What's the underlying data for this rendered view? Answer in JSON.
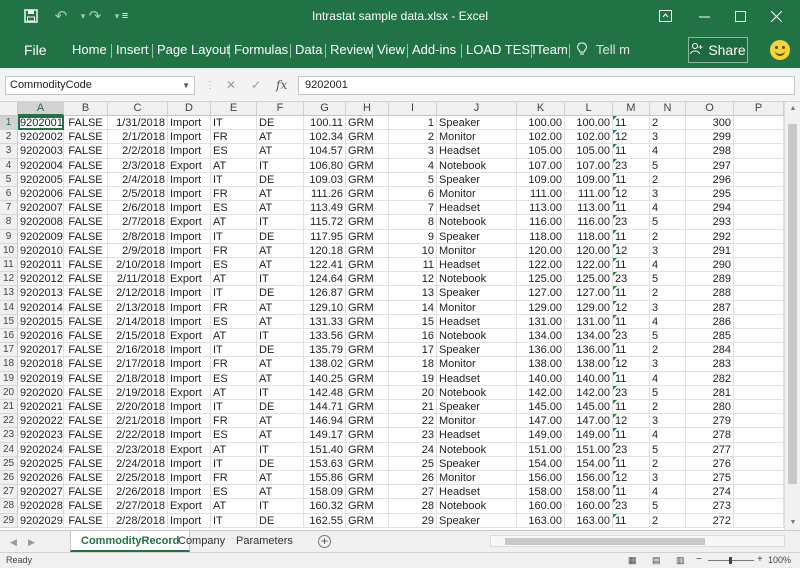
{
  "window": {
    "title": "Intrastat sample data.xlsx - Excel"
  },
  "ribbon": {
    "file": "File",
    "tabs": [
      "Home",
      "Insert",
      "Page Layout",
      "Formulas",
      "Data",
      "Review",
      "View",
      "Add-ins",
      "LOAD TEST",
      "Team"
    ],
    "tell_me": "Tell m",
    "share": "Share"
  },
  "formula_bar": {
    "name_box": "CommodityCode",
    "value": "9202001"
  },
  "columns": [
    "A",
    "B",
    "C",
    "D",
    "E",
    "F",
    "G",
    "H",
    "I",
    "J",
    "K",
    "L",
    "M",
    "N",
    "O",
    "P"
  ],
  "selected_cell": "A1",
  "rows": [
    [
      "9202001",
      "FALSE",
      "1/31/2018",
      "Import",
      "IT",
      "DE",
      "100.11",
      "GRM",
      "1",
      "Speaker",
      "100.00",
      "100.00",
      "11",
      "2",
      "300"
    ],
    [
      "9202002",
      "FALSE",
      "2/1/2018",
      "Import",
      "FR",
      "AT",
      "102.34",
      "GRM",
      "2",
      "Monitor",
      "102.00",
      "102.00",
      "12",
      "3",
      "299"
    ],
    [
      "9202003",
      "FALSE",
      "2/2/2018",
      "Import",
      "ES",
      "AT",
      "104.57",
      "GRM",
      "3",
      "Headset",
      "105.00",
      "105.00",
      "11",
      "4",
      "298"
    ],
    [
      "9202004",
      "FALSE",
      "2/3/2018",
      "Export",
      "AT",
      "IT",
      "106.80",
      "GRM",
      "4",
      "Notebook",
      "107.00",
      "107.00",
      "23",
      "5",
      "297"
    ],
    [
      "9202005",
      "FALSE",
      "2/4/2018",
      "Import",
      "IT",
      "DE",
      "109.03",
      "GRM",
      "5",
      "Speaker",
      "109.00",
      "109.00",
      "11",
      "2",
      "296"
    ],
    [
      "9202006",
      "FALSE",
      "2/5/2018",
      "Import",
      "FR",
      "AT",
      "111.26",
      "GRM",
      "6",
      "Monitor",
      "111.00",
      "111.00",
      "12",
      "3",
      "295"
    ],
    [
      "9202007",
      "FALSE",
      "2/6/2018",
      "Import",
      "ES",
      "AT",
      "113.49",
      "GRM",
      "7",
      "Headset",
      "113.00",
      "113.00",
      "11",
      "4",
      "294"
    ],
    [
      "9202008",
      "FALSE",
      "2/7/2018",
      "Export",
      "AT",
      "IT",
      "115.72",
      "GRM",
      "8",
      "Notebook",
      "116.00",
      "116.00",
      "23",
      "5",
      "293"
    ],
    [
      "9202009",
      "FALSE",
      "2/8/2018",
      "Import",
      "IT",
      "DE",
      "117.95",
      "GRM",
      "9",
      "Speaker",
      "118.00",
      "118.00",
      "11",
      "2",
      "292"
    ],
    [
      "9202010",
      "FALSE",
      "2/9/2018",
      "Import",
      "FR",
      "AT",
      "120.18",
      "GRM",
      "10",
      "Monitor",
      "120.00",
      "120.00",
      "12",
      "3",
      "291"
    ],
    [
      "9202011",
      "FALSE",
      "2/10/2018",
      "Import",
      "ES",
      "AT",
      "122.41",
      "GRM",
      "11",
      "Headset",
      "122.00",
      "122.00",
      "11",
      "4",
      "290"
    ],
    [
      "9202012",
      "FALSE",
      "2/11/2018",
      "Export",
      "AT",
      "IT",
      "124.64",
      "GRM",
      "12",
      "Notebook",
      "125.00",
      "125.00",
      "23",
      "5",
      "289"
    ],
    [
      "9202013",
      "FALSE",
      "2/12/2018",
      "Import",
      "IT",
      "DE",
      "126.87",
      "GRM",
      "13",
      "Speaker",
      "127.00",
      "127.00",
      "11",
      "2",
      "288"
    ],
    [
      "9202014",
      "FALSE",
      "2/13/2018",
      "Import",
      "FR",
      "AT",
      "129.10",
      "GRM",
      "14",
      "Monitor",
      "129.00",
      "129.00",
      "12",
      "3",
      "287"
    ],
    [
      "9202015",
      "FALSE",
      "2/14/2018",
      "Import",
      "ES",
      "AT",
      "131.33",
      "GRM",
      "15",
      "Headset",
      "131.00",
      "131.00",
      "11",
      "4",
      "286"
    ],
    [
      "9202016",
      "FALSE",
      "2/15/2018",
      "Export",
      "AT",
      "IT",
      "133.56",
      "GRM",
      "16",
      "Notebook",
      "134.00",
      "134.00",
      "23",
      "5",
      "285"
    ],
    [
      "9202017",
      "FALSE",
      "2/16/2018",
      "Import",
      "IT",
      "DE",
      "135.79",
      "GRM",
      "17",
      "Speaker",
      "136.00",
      "136.00",
      "11",
      "2",
      "284"
    ],
    [
      "9202018",
      "FALSE",
      "2/17/2018",
      "Import",
      "FR",
      "AT",
      "138.02",
      "GRM",
      "18",
      "Monitor",
      "138.00",
      "138.00",
      "12",
      "3",
      "283"
    ],
    [
      "9202019",
      "FALSE",
      "2/18/2018",
      "Import",
      "ES",
      "AT",
      "140.25",
      "GRM",
      "19",
      "Headset",
      "140.00",
      "140.00",
      "11",
      "4",
      "282"
    ],
    [
      "9202020",
      "FALSE",
      "2/19/2018",
      "Export",
      "AT",
      "IT",
      "142.48",
      "GRM",
      "20",
      "Notebook",
      "142.00",
      "142.00",
      "23",
      "5",
      "281"
    ],
    [
      "9202021",
      "FALSE",
      "2/20/2018",
      "Import",
      "IT",
      "DE",
      "144.71",
      "GRM",
      "21",
      "Speaker",
      "145.00",
      "145.00",
      "11",
      "2",
      "280"
    ],
    [
      "9202022",
      "FALSE",
      "2/21/2018",
      "Import",
      "FR",
      "AT",
      "146.94",
      "GRM",
      "22",
      "Monitor",
      "147.00",
      "147.00",
      "12",
      "3",
      "279"
    ],
    [
      "9202023",
      "FALSE",
      "2/22/2018",
      "Import",
      "ES",
      "AT",
      "149.17",
      "GRM",
      "23",
      "Headset",
      "149.00",
      "149.00",
      "11",
      "4",
      "278"
    ],
    [
      "9202024",
      "FALSE",
      "2/23/2018",
      "Export",
      "AT",
      "IT",
      "151.40",
      "GRM",
      "24",
      "Notebook",
      "151.00",
      "151.00",
      "23",
      "5",
      "277"
    ],
    [
      "9202025",
      "FALSE",
      "2/24/2018",
      "Import",
      "IT",
      "DE",
      "153.63",
      "GRM",
      "25",
      "Speaker",
      "154.00",
      "154.00",
      "11",
      "2",
      "276"
    ],
    [
      "9202026",
      "FALSE",
      "2/25/2018",
      "Import",
      "FR",
      "AT",
      "155.86",
      "GRM",
      "26",
      "Monitor",
      "156.00",
      "156.00",
      "12",
      "3",
      "275"
    ],
    [
      "9202027",
      "FALSE",
      "2/26/2018",
      "Import",
      "ES",
      "AT",
      "158.09",
      "GRM",
      "27",
      "Headset",
      "158.00",
      "158.00",
      "11",
      "4",
      "274"
    ],
    [
      "9202028",
      "FALSE",
      "2/27/2018",
      "Export",
      "AT",
      "IT",
      "160.32",
      "GRM",
      "28",
      "Notebook",
      "160.00",
      "160.00",
      "23",
      "5",
      "273"
    ],
    [
      "9202029",
      "FALSE",
      "2/28/2018",
      "Import",
      "IT",
      "DE",
      "162.55",
      "GRM",
      "29",
      "Speaker",
      "163.00",
      "163.00",
      "11",
      "2",
      "272"
    ]
  ],
  "sheet_tabs": {
    "active": "CommodityRecord",
    "others": [
      "Company",
      "Parameters"
    ]
  },
  "status": {
    "ready": "Ready",
    "zoom": "100%"
  },
  "colors": {
    "accent": "#217346"
  }
}
